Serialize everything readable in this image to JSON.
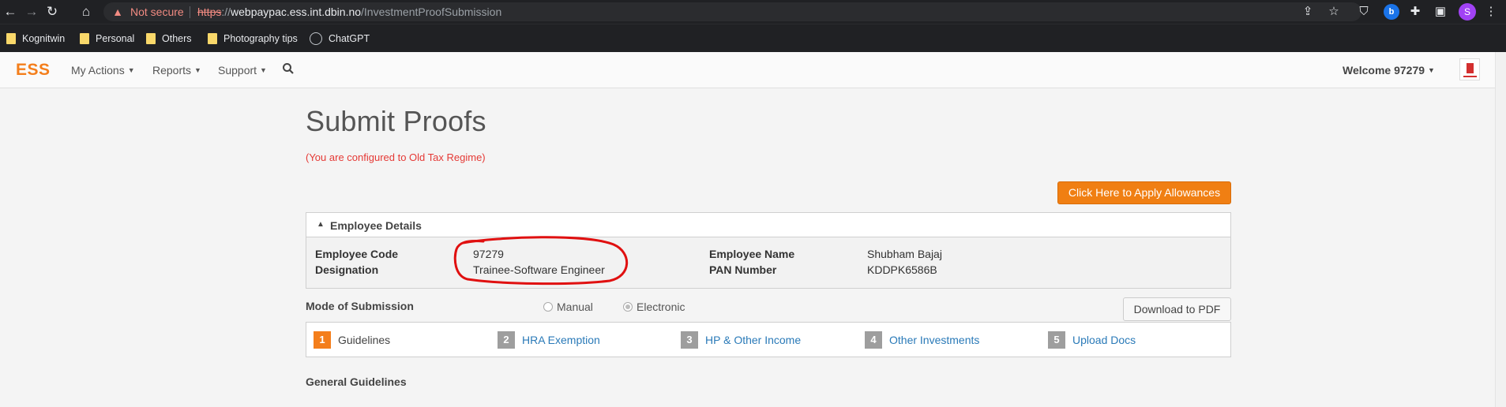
{
  "browser": {
    "security_label": "Not secure",
    "url_protocol": "https",
    "url_sep": "://",
    "url_host": "webpaypac.ess.int.dbin.no",
    "url_path": "/InvestmentProofSubmission",
    "profile_initial": "S",
    "extension_badge": "b"
  },
  "bookmarks": [
    {
      "label": "Kognitwin",
      "icon": "folder-icon"
    },
    {
      "label": "Personal",
      "icon": "folder-icon"
    },
    {
      "label": "Others",
      "icon": "folder-icon"
    },
    {
      "label": "Photography tips",
      "icon": "folder-icon"
    },
    {
      "label": "ChatGPT",
      "icon": "chatgpt-icon"
    }
  ],
  "nav": {
    "logo": "ESS",
    "menus": [
      {
        "label": "My Actions"
      },
      {
        "label": "Reports"
      },
      {
        "label": "Support"
      }
    ],
    "welcome": "Welcome 97279"
  },
  "page": {
    "title": "Submit Proofs",
    "regime_note": "(You are configured to Old Tax Regime)",
    "apply_button": "Click Here to Apply Allowances"
  },
  "employee_details": {
    "heading": "Employee Details",
    "code_label": "Employee Code",
    "code_value": "97279",
    "designation_label": "Designation",
    "designation_value": "Trainee-Software Engineer",
    "name_label": "Employee Name",
    "name_value": "Shubham Bajaj",
    "pan_label": "PAN Number",
    "pan_value": "KDDPK6586B"
  },
  "submission": {
    "label": "Mode of Submission",
    "options": [
      {
        "label": "Manual",
        "selected": false
      },
      {
        "label": "Electronic",
        "selected": true
      }
    ],
    "download_button": "Download to PDF"
  },
  "steps": [
    {
      "num": "1",
      "label": "Guidelines",
      "active": true
    },
    {
      "num": "2",
      "label": "HRA Exemption",
      "active": false
    },
    {
      "num": "3",
      "label": "HP & Other Income",
      "active": false
    },
    {
      "num": "4",
      "label": "Other Investments",
      "active": false
    },
    {
      "num": "5",
      "label": "Upload Docs",
      "active": false
    }
  ],
  "section_heading": "General Guidelines",
  "colors": {
    "accent": "#f47e1b",
    "button_orange": "#f07f13",
    "link": "#2a7ab8",
    "warning_red": "#e53935",
    "annotation_red": "#e01010"
  }
}
